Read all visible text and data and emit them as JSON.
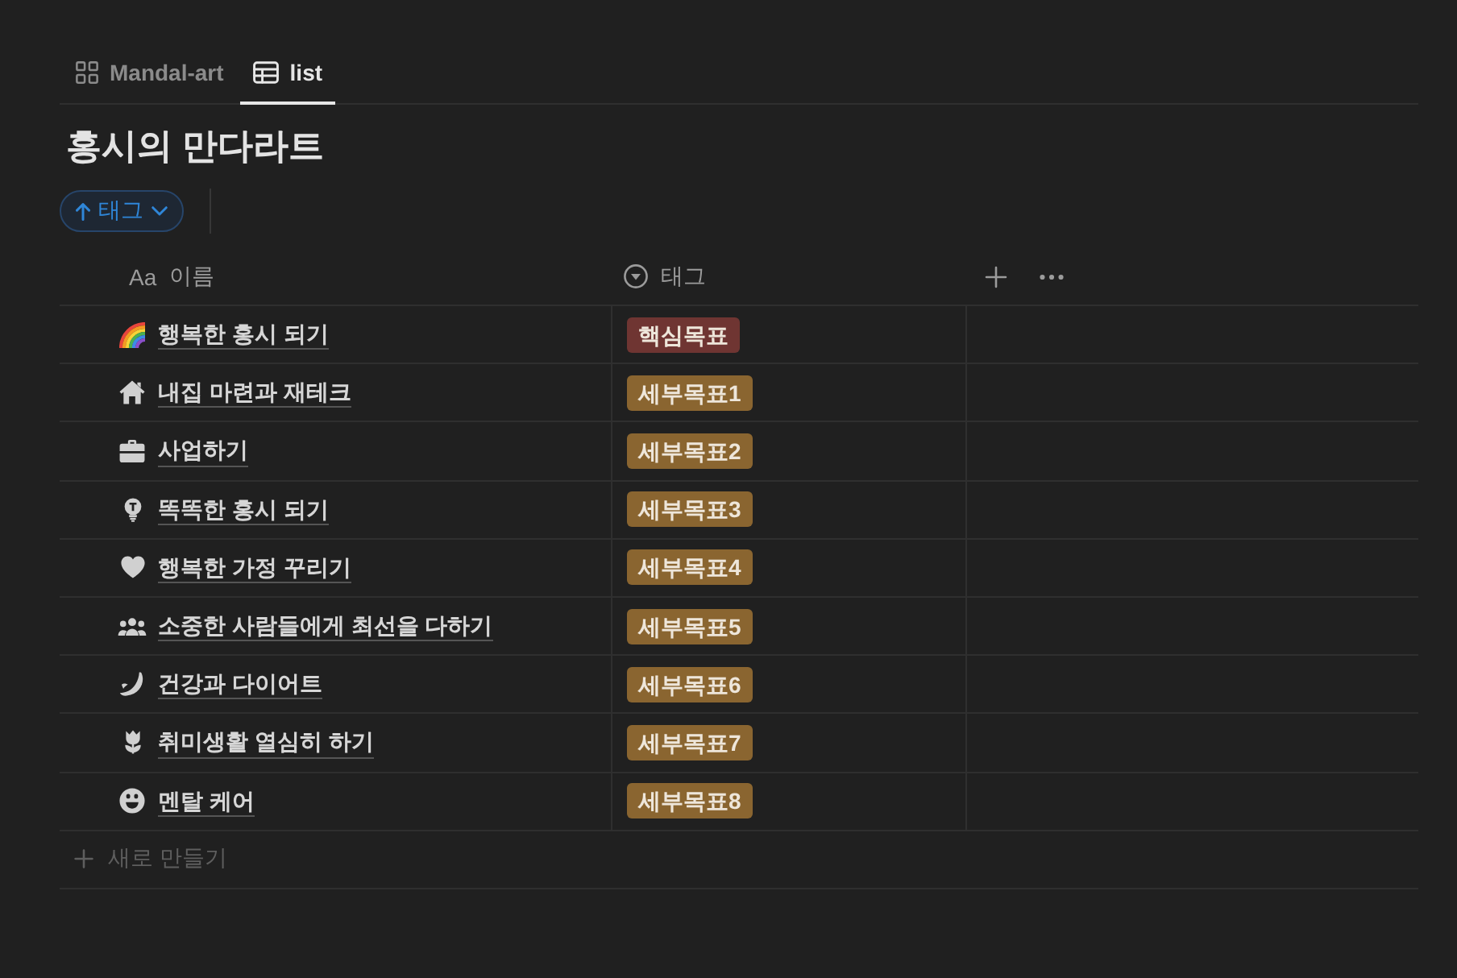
{
  "tabs": [
    {
      "label": "Mandal-art",
      "kind": "gallery",
      "selected": false
    },
    {
      "label": "list",
      "kind": "table",
      "selected": true
    }
  ],
  "title": "홍시의 만다라트",
  "sort_chip": {
    "label": "태그"
  },
  "table": {
    "columns": [
      {
        "kind": "title",
        "type_glyph": "Aa",
        "label": "이름"
      },
      {
        "kind": "select",
        "label": "태그"
      }
    ],
    "rows": [
      {
        "name": "행복한 홍시 되기",
        "tag": {
          "label": "핵심목표",
          "color": "#6f3532"
        }
      },
      {
        "name": "내집 마련과 재테크",
        "tag": {
          "label": "세부목표1",
          "color": "#8a6530"
        }
      },
      {
        "name": "사업하기",
        "tag": {
          "label": "세부목표2",
          "color": "#8a6530"
        }
      },
      {
        "name": "똑똑한 홍시 되기",
        "tag": {
          "label": "세부목표3",
          "color": "#8a6530"
        }
      },
      {
        "name": "행복한 가정 꾸리기",
        "tag": {
          "label": "세부목표4",
          "color": "#8a6530"
        }
      },
      {
        "name": "소중한 사람들에게 최선을 다하기",
        "tag": {
          "label": "세부목표5",
          "color": "#8a6530"
        }
      },
      {
        "name": "건강과 다이어트",
        "tag": {
          "label": "세부목표6",
          "color": "#8a6530"
        }
      },
      {
        "name": "취미생활 열심히 하기",
        "tag": {
          "label": "세부목표7",
          "color": "#8a6530"
        }
      },
      {
        "name": "멘탈 케어",
        "tag": {
          "label": "세부목표8",
          "color": "#8a6530"
        }
      }
    ],
    "new_row_label": "새로 만들기"
  }
}
